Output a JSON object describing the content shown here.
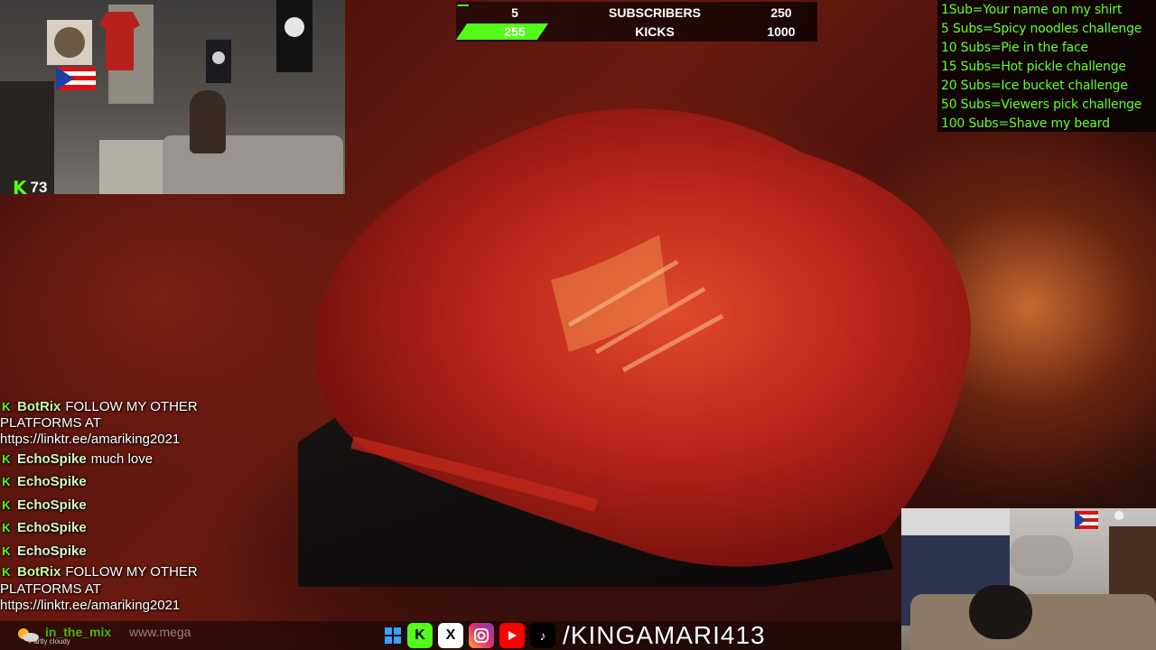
{
  "top_bar": {
    "subscribers": {
      "current": "5",
      "label": "SUBSCRIBERS",
      "target": "250",
      "fill_fraction": 0.02
    },
    "kicks": {
      "current": "255",
      "label": "KICKS",
      "target": "1000",
      "fill_fraction": 0.255
    }
  },
  "webcam_top": {
    "kick_count": "73"
  },
  "sub_goals": [
    "1Sub=Your name on my shirt",
    "5 Subs=Spicy noodles challenge",
    "10 Subs=Pie in the face",
    "15 Subs=Hot pickle challenge",
    "20 Subs=Ice bucket challenge",
    "50 Subs=Viewers pick challenge",
    "100 Subs=Shave my beard"
  ],
  "chat": {
    "messages": [
      {
        "user": "BotRix",
        "text": "FOLLOW MY OTHER PLATFORMS AT https://linktr.ee/amariking2021"
      },
      {
        "user": "EchoSpike",
        "text": "much love"
      },
      {
        "user": "EchoSpike",
        "text": ""
      },
      {
        "user": "EchoSpike",
        "text": ""
      },
      {
        "user": "EchoSpike",
        "text": ""
      },
      {
        "user": "EchoSpike",
        "text": ""
      },
      {
        "user": "BotRix",
        "text": "FOLLOW MY OTHER PLATFORMS AT https://linktr.ee/amariking2021"
      }
    ],
    "message1_line1": "FOLLOW MY OTHER",
    "message1_line2": "PLATFORMS AT",
    "message1_line3": "https://linktr.ee/amariking2021",
    "message7_line1": "FOLLOW MY OTHER",
    "message7_line2": "PLATFORMS AT",
    "message7_line3": "https://linktr.ee/amariking2021"
  },
  "bottom_strip": {
    "weather": "Partly cloudy",
    "ticker_user": "in_the_mix",
    "ticker_url": "www.mega",
    "handle": "/KINGAMARI413"
  },
  "social_icons": [
    "kick-icon",
    "x-icon",
    "instagram-icon",
    "youtube-icon",
    "tiktok-icon"
  ],
  "colors": {
    "kick_green": "#53fc18",
    "goal_text_green": "#64ff2a",
    "youtube_red": "#ff0000"
  }
}
